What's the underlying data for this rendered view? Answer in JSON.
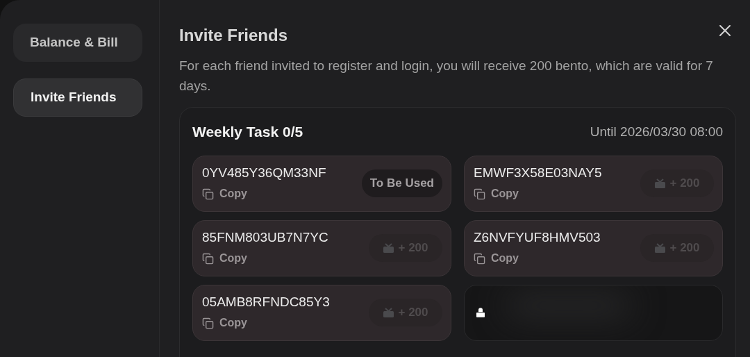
{
  "sidebar": {
    "items": [
      {
        "label": "Balance & Bill",
        "selected": false
      },
      {
        "label": "Invite Friends",
        "selected": true
      }
    ]
  },
  "title": "Invite Friends",
  "description": "For each friend invited to register and login, you will receive 200 bento, which are valid for 7 days.",
  "task": {
    "title": "Weekly Task 0/5",
    "until": "Until 2026/03/30 08:00",
    "codes": [
      {
        "kind": "code",
        "code": "0YV485Y36QM33NF",
        "copy": "Copy",
        "status": "To Be Used"
      },
      {
        "kind": "code",
        "code": "EMWF3X58E03NAY5",
        "copy": "Copy",
        "reward": "+ 200"
      },
      {
        "kind": "code",
        "code": "85FNM803UB7N7YC",
        "copy": "Copy",
        "reward": "+ 200"
      },
      {
        "kind": "code",
        "code": "Z6NVFYUF8HMV503",
        "copy": "Copy",
        "reward": "+ 200"
      },
      {
        "kind": "code",
        "code": "05AMB8RFNDC85Y3",
        "copy": "Copy",
        "reward": "+ 200"
      },
      {
        "kind": "locked"
      }
    ]
  }
}
